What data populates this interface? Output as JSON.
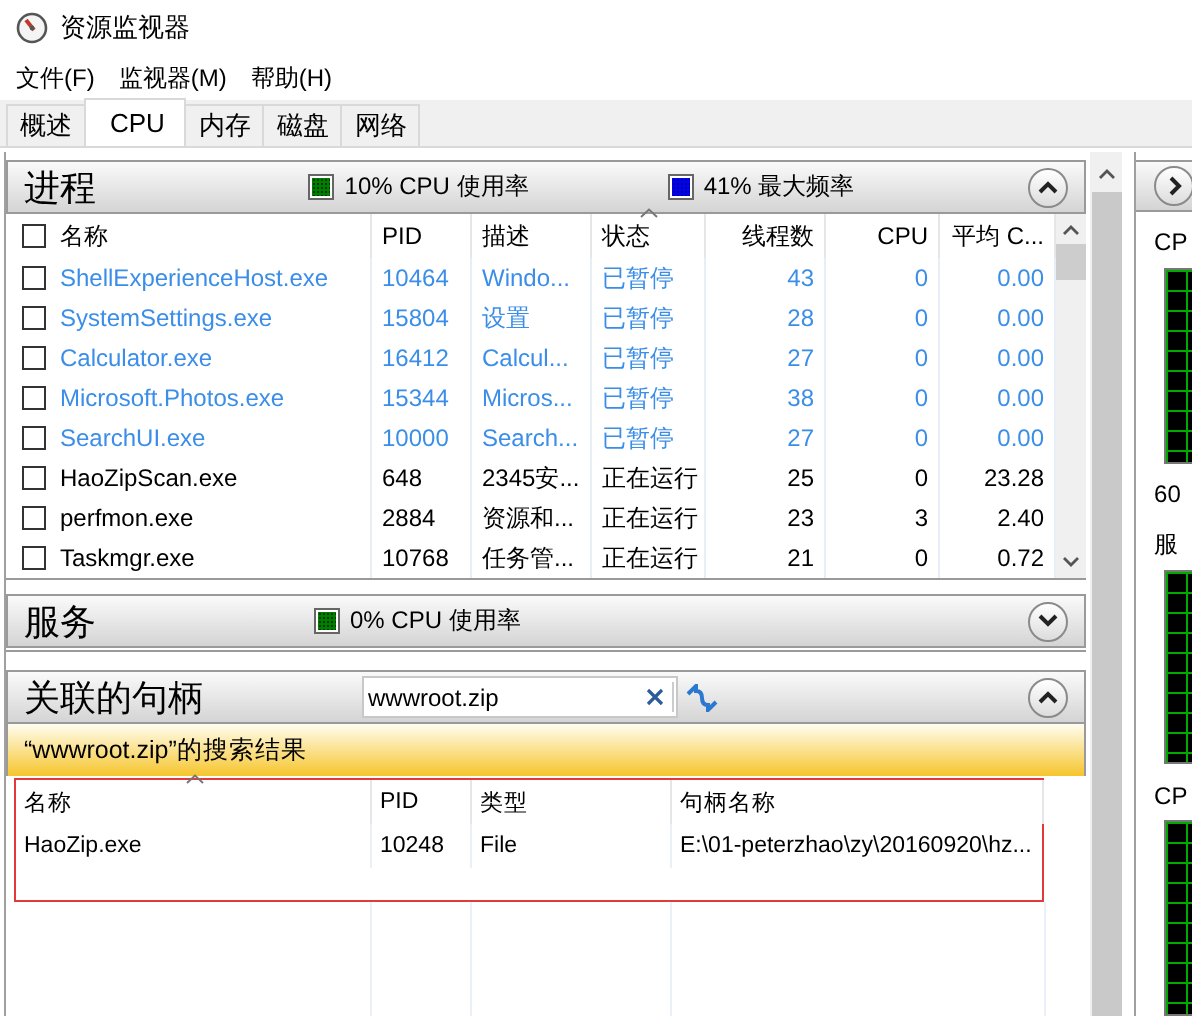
{
  "window": {
    "title": "资源监视器"
  },
  "menu": [
    "文件(F)",
    "监视器(M)",
    "帮助(H)"
  ],
  "tabs": [
    {
      "label": "概述",
      "selected": false
    },
    {
      "label": "CPU",
      "selected": true
    },
    {
      "label": "内存",
      "selected": false
    },
    {
      "label": "磁盘",
      "selected": false
    },
    {
      "label": "网络",
      "selected": false
    }
  ],
  "processes": {
    "title": "进程",
    "expanded": true,
    "indicators": [
      {
        "text": "10% CPU 使用率",
        "color": "#008000"
      },
      {
        "text": "41% 最大频率",
        "color": "#0000ff"
      }
    ],
    "select_all": {
      "checked": false
    },
    "columns": [
      {
        "label": "名称",
        "sorted": false
      },
      {
        "label": "PID",
        "sorted": false
      },
      {
        "label": "描述",
        "sorted": false
      },
      {
        "label": "状态",
        "sorted": true
      },
      {
        "label": "线程数",
        "sorted": false
      },
      {
        "label": "CPU",
        "sorted": false
      },
      {
        "label": "平均 C...",
        "sorted": false
      }
    ],
    "rows": [
      {
        "name": "ShellExperienceHost.exe",
        "pid": "10464",
        "description": "Windo...",
        "status": "已暂停",
        "threads": "43",
        "cpu": "0",
        "avg_cpu": "0.00",
        "checked": false,
        "suspended": true
      },
      {
        "name": "SystemSettings.exe",
        "pid": "15804",
        "description": "设置",
        "status": "已暂停",
        "threads": "28",
        "cpu": "0",
        "avg_cpu": "0.00",
        "checked": false,
        "suspended": true
      },
      {
        "name": "Calculator.exe",
        "pid": "16412",
        "description": "Calcul...",
        "status": "已暂停",
        "threads": "27",
        "cpu": "0",
        "avg_cpu": "0.00",
        "checked": false,
        "suspended": true
      },
      {
        "name": "Microsoft.Photos.exe",
        "pid": "15344",
        "description": "Micros...",
        "status": "已暂停",
        "threads": "38",
        "cpu": "0",
        "avg_cpu": "0.00",
        "checked": false,
        "suspended": true
      },
      {
        "name": "SearchUI.exe",
        "pid": "10000",
        "description": "Search...",
        "status": "已暂停",
        "threads": "27",
        "cpu": "0",
        "avg_cpu": "0.00",
        "checked": false,
        "suspended": true
      },
      {
        "name": "HaoZipScan.exe",
        "pid": "648",
        "description": "2345安...",
        "status": "正在运行",
        "threads": "25",
        "cpu": "0",
        "avg_cpu": "23.28",
        "checked": false,
        "suspended": false
      },
      {
        "name": "perfmon.exe",
        "pid": "2884",
        "description": "资源和...",
        "status": "正在运行",
        "threads": "23",
        "cpu": "3",
        "avg_cpu": "2.40",
        "checked": false,
        "suspended": false
      },
      {
        "name": "Taskmgr.exe",
        "pid": "10768",
        "description": "任务管...",
        "status": "正在运行",
        "threads": "21",
        "cpu": "0",
        "avg_cpu": "0.72",
        "checked": false,
        "suspended": false
      }
    ]
  },
  "services": {
    "title": "服务",
    "expanded": false,
    "indicators": [
      {
        "text": "0% CPU 使用率",
        "color": "#008000"
      }
    ]
  },
  "handles": {
    "title": "关联的句柄",
    "expanded": true,
    "search": {
      "value": "wwwroot.zip"
    },
    "result_banner": "“wwwroot.zip”的搜索结果",
    "columns": [
      {
        "label": "名称",
        "sorted": true
      },
      {
        "label": "PID",
        "sorted": false
      },
      {
        "label": "类型",
        "sorted": false
      },
      {
        "label": "句柄名称",
        "sorted": false
      }
    ],
    "rows": [
      {
        "name": "HaoZip.exe",
        "pid": "10248",
        "type": "File",
        "handle_name": "E:\\01-peterzhao\\zy\\20160920\\hz..."
      }
    ]
  },
  "side_panel": {
    "items": [
      {
        "kind": "label",
        "text": "CP"
      },
      {
        "kind": "graph"
      },
      {
        "kind": "label",
        "text": "60"
      },
      {
        "kind": "label",
        "text": "服"
      },
      {
        "kind": "graph"
      },
      {
        "kind": "label",
        "text": "CP"
      },
      {
        "kind": "graph"
      }
    ]
  }
}
